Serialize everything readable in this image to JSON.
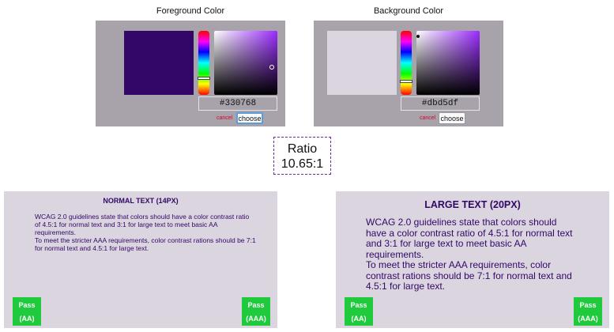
{
  "foreground": {
    "title": "Foreground Color",
    "color": "#330768",
    "hex_value": "#330768",
    "cancel_label": "cancel",
    "choose_label": "choose"
  },
  "background": {
    "title": "Background Color",
    "color": "#dbd5df",
    "hex_value": "#dbd5df",
    "cancel_label": "cancel",
    "choose_label": "choose"
  },
  "ratio": {
    "label": "Ratio",
    "value": "10.65:1"
  },
  "normal_text": {
    "heading": "NORMAL TEXT (14PX)",
    "body_line1": "WCAG 2.0 guidelines state that colors should have a color contrast ratio of 4.5:1 for normal text and 3:1 for large text to meet basic AA requirements.",
    "body_line2": "To meet the stricter AAA requirements, color contrast rations should be 7:1 for normal text and 4.5:1 for large text.",
    "badge_aa_pass": "Pass",
    "badge_aa_level": "(AA)",
    "badge_aaa_pass": "Pass",
    "badge_aaa_level": "(AAA)"
  },
  "large_text": {
    "heading": "LARGE TEXT (20PX)",
    "body_line1": "WCAG 2.0 guidelines state that colors should have a color contrast ratio of 4.5:1 for normal text and 3:1 for large text to meet basic AA requirements.",
    "body_line2": "To meet the stricter AAA requirements, color contrast rations should be 7:1 for normal text and 4.5:1 for large text.",
    "badge_aa_pass": "Pass",
    "badge_aa_level": "(AA)",
    "badge_aaa_pass": "Pass",
    "badge_aaa_level": "(AAA)"
  },
  "colors": {
    "panel_gray": "#a8a3ab",
    "pass_green": "#1fcb3c",
    "cancel_red": "#d9002a",
    "text_purple": "#330768"
  }
}
